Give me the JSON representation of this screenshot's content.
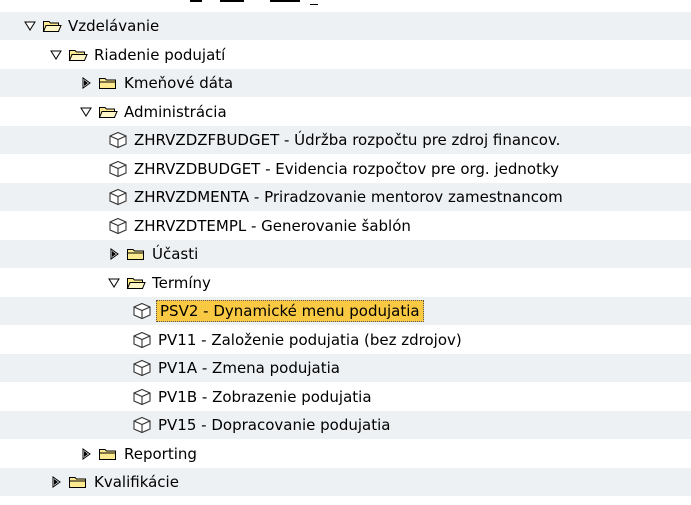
{
  "colors": {
    "row_alt_bg": "#eef1f4",
    "selection_bg": "#f9c943",
    "folder_fill": "#fde98f",
    "folder_stroke": "#000000"
  },
  "icons": {
    "expanded": "triangle-down-icon",
    "collapsed": "triangle-right-icon",
    "folder_open": "folder-open-icon",
    "folder_closed": "folder-icon",
    "transaction": "transaction-cube-icon"
  },
  "tree": {
    "nodes": [
      {
        "label": "Vzdelávanie",
        "type": "folder",
        "state": "expanded",
        "level": 0,
        "selected": false
      },
      {
        "label": "Riadenie podujatí",
        "type": "folder",
        "state": "expanded",
        "level": 1,
        "selected": false
      },
      {
        "label": "Kmeňové dáta",
        "type": "folder",
        "state": "collapsed",
        "level": 2,
        "selected": false
      },
      {
        "label": "Administrácia",
        "type": "folder",
        "state": "expanded",
        "level": 2,
        "selected": false
      },
      {
        "label": "ZHRVZDZFBUDGET - Údržba rozpočtu pre zdroj financov.",
        "type": "transaction",
        "level": 3,
        "selected": false
      },
      {
        "label": "ZHRVZDBUDGET - Evidencia rozpočtov pre org. jednotky",
        "type": "transaction",
        "level": 3,
        "selected": false
      },
      {
        "label": "ZHRVZDMENTA - Priradzovanie mentorov zamestnancom",
        "type": "transaction",
        "level": 3,
        "selected": false
      },
      {
        "label": "ZHRVZDTEMPL - Generovanie šablón",
        "type": "transaction",
        "level": 3,
        "selected": false
      },
      {
        "label": "Účasti",
        "type": "folder",
        "state": "collapsed",
        "level": 3,
        "selected": false
      },
      {
        "label": "Termíny",
        "type": "folder",
        "state": "expanded",
        "level": 3,
        "selected": false
      },
      {
        "label": "PSV2 - Dynamické menu podujatia",
        "type": "transaction",
        "level": 4,
        "selected": true
      },
      {
        "label": "PV11 - Založenie podujatia (bez zdrojov)",
        "type": "transaction",
        "level": 4,
        "selected": false
      },
      {
        "label": "PV1A - Zmena podujatia",
        "type": "transaction",
        "level": 4,
        "selected": false
      },
      {
        "label": "PV1B - Zobrazenie podujatia",
        "type": "transaction",
        "level": 4,
        "selected": false
      },
      {
        "label": "PV15 - Dopracovanie podujatia",
        "type": "transaction",
        "level": 4,
        "selected": false
      },
      {
        "label": "Reporting",
        "type": "folder",
        "state": "collapsed",
        "level": 2,
        "selected": false
      },
      {
        "label": "Kvalifikácie",
        "type": "folder",
        "state": "collapsed",
        "level": 1,
        "selected": false
      }
    ]
  }
}
